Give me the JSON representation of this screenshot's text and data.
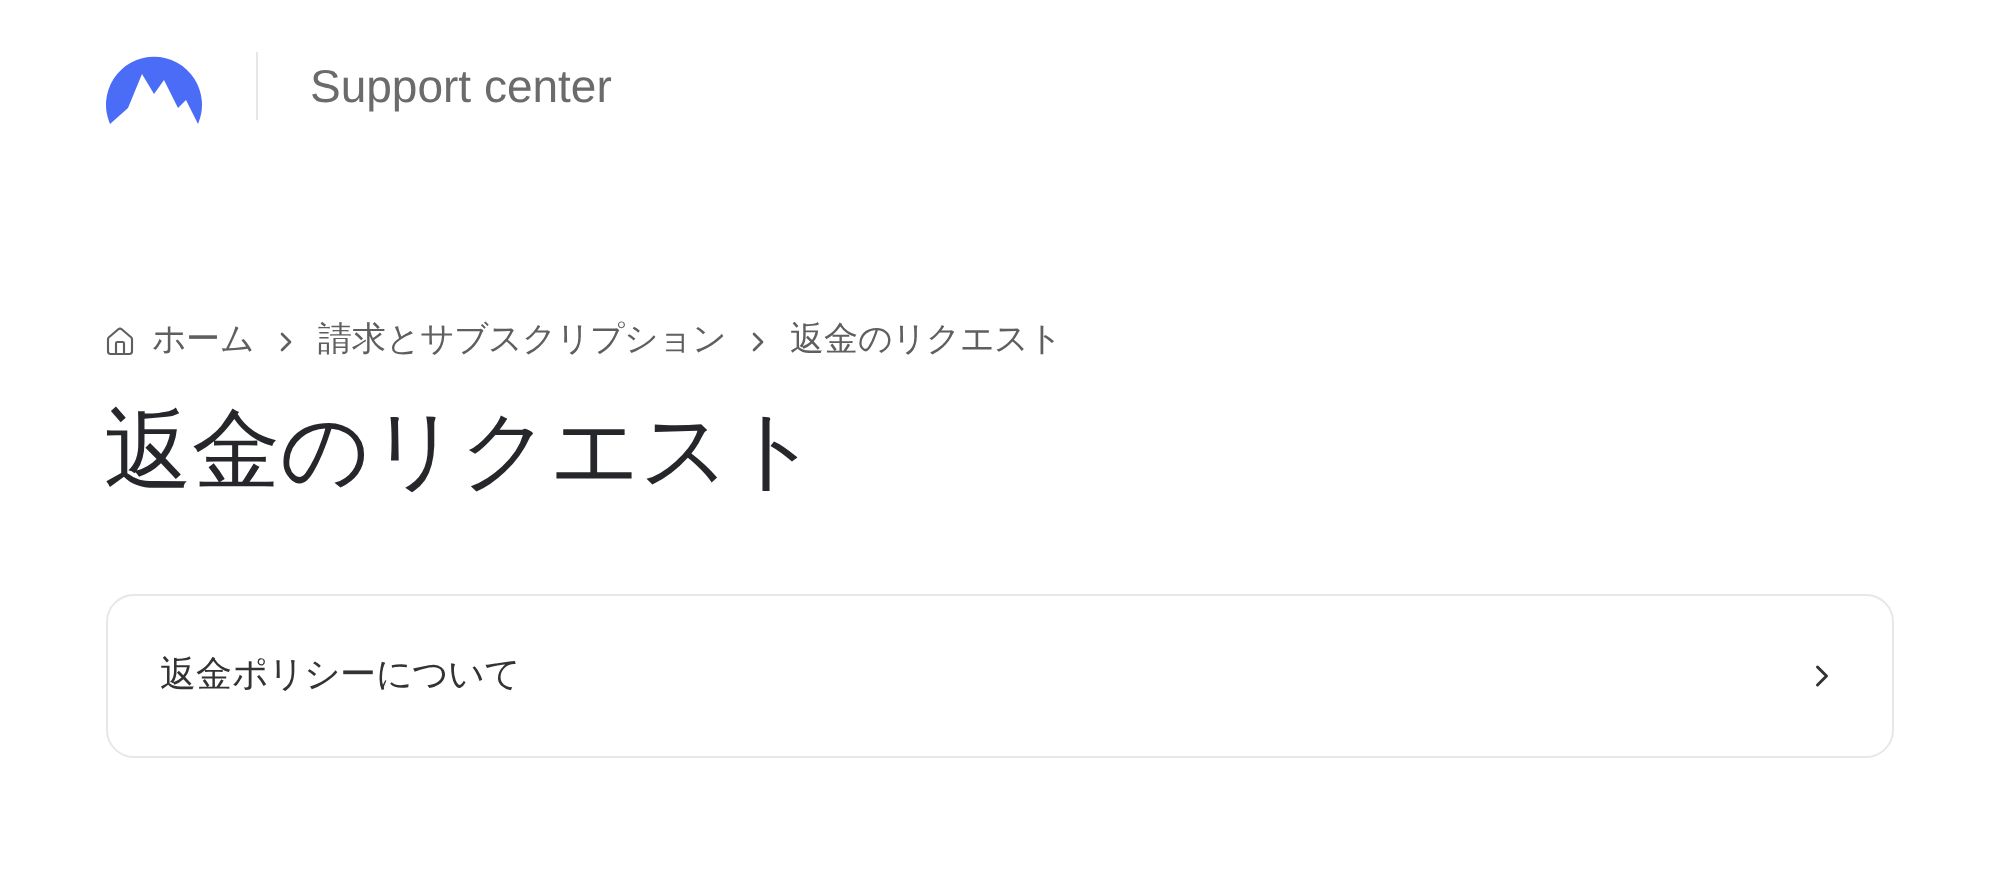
{
  "header": {
    "title": "Support center"
  },
  "breadcrumb": [
    {
      "label": "ホーム",
      "kind": "home"
    },
    {
      "label": "請求とサブスクリプション",
      "kind": "link"
    },
    {
      "label": "返金のリクエスト",
      "kind": "current"
    }
  ],
  "page_title": "返金のリクエスト",
  "articles": [
    {
      "label": "返金ポリシーについて"
    }
  ]
}
